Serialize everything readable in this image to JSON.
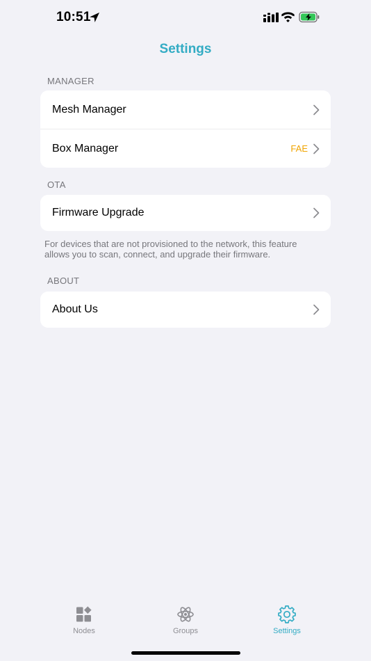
{
  "status_bar": {
    "time": "10:51"
  },
  "nav": {
    "title": "Settings"
  },
  "sections": {
    "manager": {
      "header": "MANAGER",
      "rows": [
        {
          "label": "Mesh Manager"
        },
        {
          "label": "Box Manager",
          "detail": "FAE"
        }
      ]
    },
    "ota": {
      "header": "OTA",
      "rows": [
        {
          "label": "Firmware Upgrade"
        }
      ],
      "footer": "For devices that are not provisioned to the network, this feature allows you to scan, connect, and upgrade their firmware."
    },
    "about": {
      "header": "ABOUT",
      "rows": [
        {
          "label": "About Us"
        }
      ]
    }
  },
  "tab_bar": {
    "tabs": [
      {
        "label": "Nodes",
        "icon": "nodes-icon"
      },
      {
        "label": "Groups",
        "icon": "groups-icon"
      },
      {
        "label": "Settings",
        "icon": "gear-icon",
        "active": true
      }
    ]
  },
  "colors": {
    "accent": "#33acc4",
    "detail": "#f0a400",
    "background": "#f2f2f7",
    "secondary_text": "#76767b",
    "inactive_tab": "#8e8e93"
  }
}
